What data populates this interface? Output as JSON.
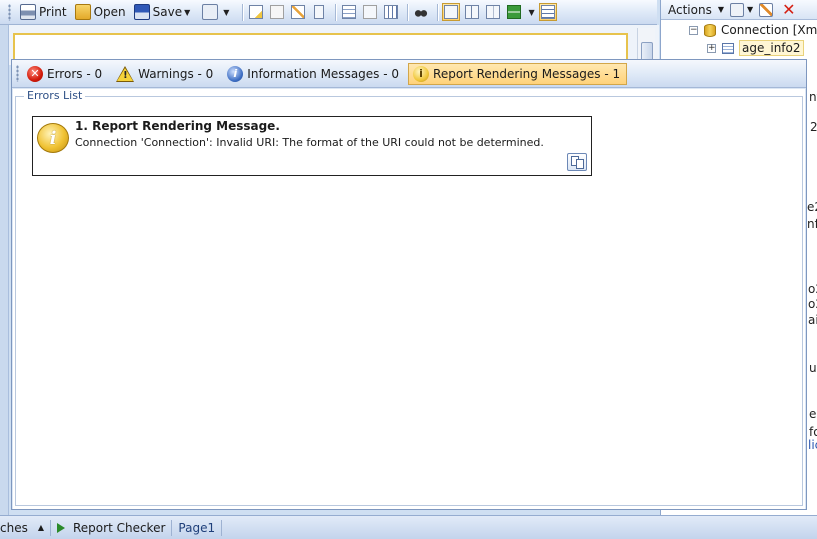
{
  "toolbar": {
    "print_label": "Print",
    "open_label": "Open",
    "save_label": "Save"
  },
  "right_panel": {
    "actions_label": "Actions",
    "tree": [
      {
        "label": "Connection [Xml Da",
        "icon": "database-icon"
      },
      {
        "label": "age_info2",
        "icon": "table-icon"
      }
    ],
    "clipped_fragments": [
      "nf",
      "2",
      "e2",
      "nfo",
      "o2",
      "o2",
      "ail",
      "ul",
      "e",
      "fo",
      "lic"
    ]
  },
  "error_window": {
    "tabs": [
      {
        "label": "Errors - 0",
        "icon": "error-icon",
        "active": false
      },
      {
        "label": "Warnings - 0",
        "icon": "warning-icon",
        "active": false
      },
      {
        "label": "Information Messages - 0",
        "icon": "info-icon",
        "active": false
      },
      {
        "label": "Report Rendering Messages - 1",
        "icon": "rendering-message-icon",
        "active": true
      }
    ],
    "list_title": "Errors List",
    "messages": [
      {
        "title": "1. Report Rendering Message.",
        "body": "Connection 'Connection': Invalid URI: The format of the URI could not be determined.",
        "icon": "info-bulb-icon"
      }
    ]
  },
  "bottom_bar": {
    "left_fragment": "ches",
    "report_checker_label": "Report Checker",
    "page_label": "Page1"
  },
  "colors": {
    "active_tab": "#ffd27a",
    "accent_border": "#e7c34d",
    "error_red": "#d21a0a"
  }
}
